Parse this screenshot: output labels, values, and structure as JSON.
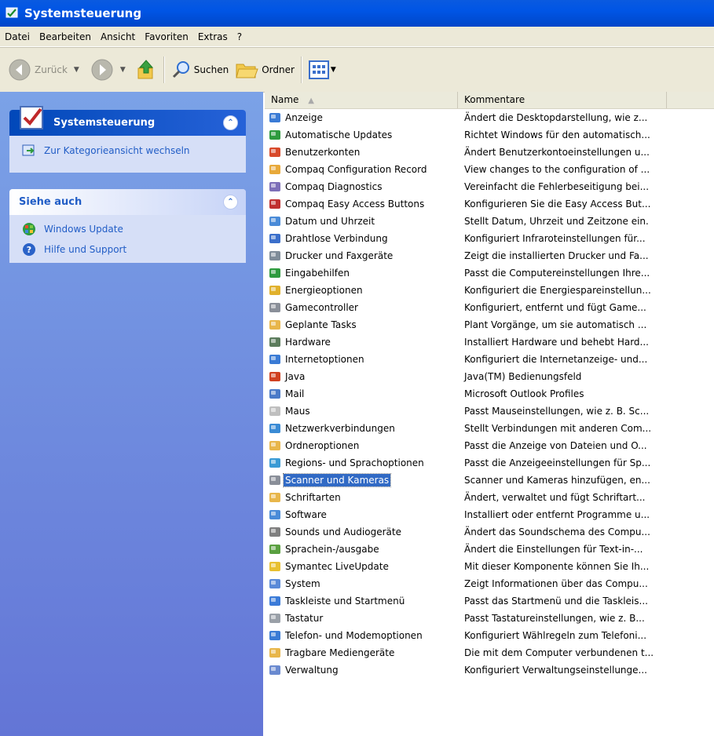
{
  "window": {
    "title": "Systemsteuerung"
  },
  "menu": [
    "Datei",
    "Bearbeiten",
    "Ansicht",
    "Favoriten",
    "Extras",
    "?"
  ],
  "toolbar": {
    "back": "Zurück",
    "search": "Suchen",
    "folder": "Ordner"
  },
  "sidebar": {
    "panel1": {
      "title": "Systemsteuerung",
      "link": "Zur Kategorieansicht wechseln"
    },
    "panel2": {
      "title": "Siehe auch",
      "links": [
        "Windows Update",
        "Hilfe und Support"
      ]
    }
  },
  "list": {
    "headers": {
      "name": "Name",
      "comment": "Kommentare"
    },
    "selected_index": 21,
    "items": [
      {
        "name": "Anzeige",
        "comment": "Ändert die Desktopdarstellung, wie z...",
        "icon": "display-icon",
        "color": "#3a7bd5"
      },
      {
        "name": "Automatische Updates",
        "comment": "Richtet Windows für den automatisch...",
        "icon": "windows-update-icon",
        "color": "#2e9b3e"
      },
      {
        "name": "Benutzerkonten",
        "comment": "Ändert Benutzerkontoeinstellungen u...",
        "icon": "users-icon",
        "color": "#d84a2a"
      },
      {
        "name": "Compaq Configuration Record",
        "comment": "View changes to the configuration of ...",
        "icon": "magnifier-icon",
        "color": "#e8a93a"
      },
      {
        "name": "Compaq Diagnostics",
        "comment": "Vereinfacht die Fehlerbeseitigung bei...",
        "icon": "diagnostics-icon",
        "color": "#7d6fb8"
      },
      {
        "name": "Compaq Easy Access Buttons",
        "comment": "Konfigurieren Sie die Easy Access But...",
        "icon": "buttons-icon",
        "color": "#c03030"
      },
      {
        "name": "Datum und Uhrzeit",
        "comment": "Stellt Datum, Uhrzeit und Zeitzone ein.",
        "icon": "clock-icon",
        "color": "#4a8bd8"
      },
      {
        "name": "Drahtlose Verbindung",
        "comment": "Konfiguriert Infraroteinstellungen für...",
        "icon": "wireless-icon",
        "color": "#3b6fcb"
      },
      {
        "name": "Drucker und Faxgeräte",
        "comment": "Zeigt die installierten Drucker und Fa...",
        "icon": "printer-icon",
        "color": "#7f8c99"
      },
      {
        "name": "Eingabehilfen",
        "comment": "Passt die Computereinstellungen Ihre...",
        "icon": "accessibility-icon",
        "color": "#2e9b3e"
      },
      {
        "name": "Energieoptionen",
        "comment": "Konfiguriert die Energiespareinstellun...",
        "icon": "power-icon",
        "color": "#e1b12c"
      },
      {
        "name": "Gamecontroller",
        "comment": "Konfiguriert, entfernt und fügt Game...",
        "icon": "gamepad-icon",
        "color": "#8a8f99"
      },
      {
        "name": "Geplante Tasks",
        "comment": "Plant Vorgänge, um sie automatisch ...",
        "icon": "tasks-icon",
        "color": "#e8b64a"
      },
      {
        "name": "Hardware",
        "comment": "Installiert Hardware und behebt Hard...",
        "icon": "hardware-icon",
        "color": "#5c7c5c"
      },
      {
        "name": "Internetoptionen",
        "comment": "Konfiguriert die Internetanzeige- und...",
        "icon": "internet-icon",
        "color": "#3a7bd5"
      },
      {
        "name": "Java",
        "comment": "Java(TM) Bedienungsfeld",
        "icon": "java-icon",
        "color": "#d04020"
      },
      {
        "name": "Mail",
        "comment": "Microsoft Outlook Profiles",
        "icon": "mail-icon",
        "color": "#4a7ac8"
      },
      {
        "name": "Maus",
        "comment": "Passt Mauseinstellungen, wie z. B. Sc...",
        "icon": "mouse-icon",
        "color": "#bfbfbf"
      },
      {
        "name": "Netzwerkverbindungen",
        "comment": "Stellt Verbindungen mit anderen Com...",
        "icon": "network-icon",
        "color": "#3a8bd5"
      },
      {
        "name": "Ordneroptionen",
        "comment": "Passt die Anzeige von Dateien und O...",
        "icon": "folder-options-icon",
        "color": "#e8b64a"
      },
      {
        "name": "Regions- und Sprachoptionen",
        "comment": "Passt die Anzeigeeinstellungen für Sp...",
        "icon": "globe-icon",
        "color": "#3a9bd5"
      },
      {
        "name": "Scanner und Kameras",
        "comment": "Scanner und Kameras hinzufügen, en...",
        "icon": "scanner-icon",
        "color": "#8a8f99"
      },
      {
        "name": "Schriftarten",
        "comment": "Ändert, verwaltet und fügt Schriftart...",
        "icon": "fonts-folder-icon",
        "color": "#e8b64a"
      },
      {
        "name": "Software",
        "comment": "Installiert oder entfernt Programme u...",
        "icon": "software-icon",
        "color": "#4a8bd8"
      },
      {
        "name": "Sounds und Audiogeräte",
        "comment": "Ändert das Soundschema des Compu...",
        "icon": "speaker-icon",
        "color": "#7f7f7f"
      },
      {
        "name": "Sprachein-/ausgabe",
        "comment": "Ändert die Einstellungen für Text-in-...",
        "icon": "speech-icon",
        "color": "#5aa040"
      },
      {
        "name": "Symantec LiveUpdate",
        "comment": "Mit dieser Komponente können Sie Ih...",
        "icon": "liveupdate-icon",
        "color": "#e8c030"
      },
      {
        "name": "System",
        "comment": "Zeigt Informationen über das Compu...",
        "icon": "system-icon",
        "color": "#5a8ad8"
      },
      {
        "name": "Taskleiste und Startmenü",
        "comment": "Passt das Startmenü und die Taskleis...",
        "icon": "taskbar-icon",
        "color": "#3b7bd8"
      },
      {
        "name": "Tastatur",
        "comment": "Passt Tastatureinstellungen, wie z. B...",
        "icon": "keyboard-icon",
        "color": "#9aa0a8"
      },
      {
        "name": "Telefon- und Modemoptionen",
        "comment": "Konfiguriert Wählregeln zum Telefoni...",
        "icon": "phone-icon",
        "color": "#3a7bd5"
      },
      {
        "name": "Tragbare Mediengeräte",
        "comment": "Die mit dem Computer verbundenen t...",
        "icon": "media-device-icon",
        "color": "#e8b64a"
      },
      {
        "name": "Verwaltung",
        "comment": "Konfiguriert Verwaltungseinstellunge...",
        "icon": "admin-tools-icon",
        "color": "#6a8ad0"
      }
    ]
  }
}
